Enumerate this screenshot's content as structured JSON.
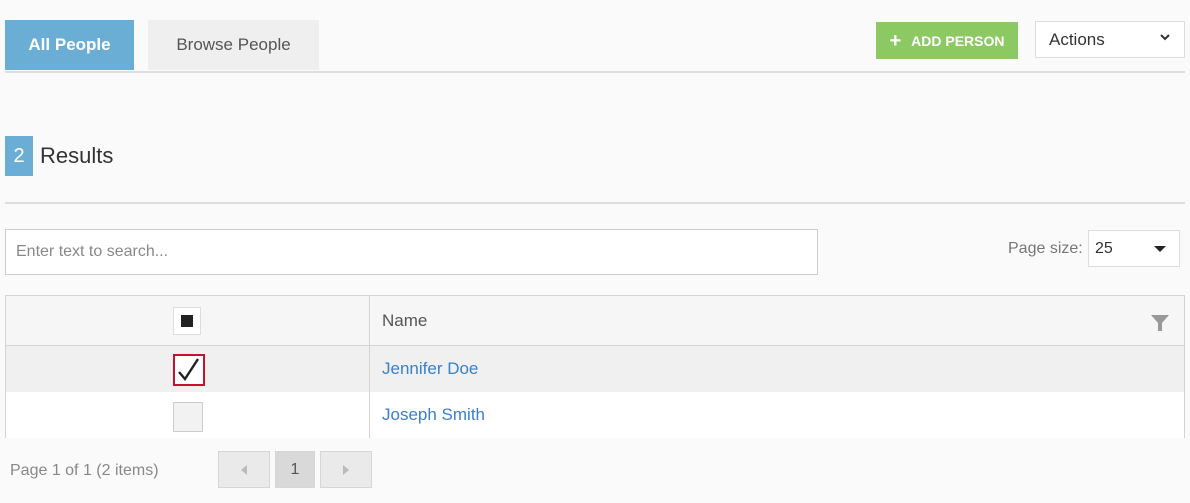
{
  "tabs": [
    {
      "label": "All People",
      "active": true
    },
    {
      "label": "Browse People",
      "active": false
    }
  ],
  "toolbar": {
    "add_icon": "+",
    "add_label": "ADD PERSON",
    "actions_label": "Actions"
  },
  "results": {
    "count": "2",
    "label": "Results"
  },
  "search": {
    "placeholder": "Enter text to search...",
    "value": ""
  },
  "page_size": {
    "label": "Page size:",
    "value": "25"
  },
  "grid": {
    "columns": [
      "",
      "Name"
    ],
    "rows": [
      {
        "name": "Jennifer Doe",
        "checked": true
      },
      {
        "name": "Joseph Smith",
        "checked": false
      }
    ]
  },
  "pager": {
    "summary": "Page 1 of 1 (2 items)",
    "current_page": "1"
  },
  "colors": {
    "accent": "#6aaed6",
    "add_button": "#8dc963",
    "link": "#3a7fca",
    "checked_border": "#c4122f"
  },
  "icons": {
    "add": "plus-icon",
    "actions": "chevron-down-icon",
    "page_size": "caret-down-icon",
    "column_filter": "filter-icon",
    "checked": "checkmark-icon",
    "prev": "caret-left-icon",
    "next": "caret-right-icon"
  }
}
